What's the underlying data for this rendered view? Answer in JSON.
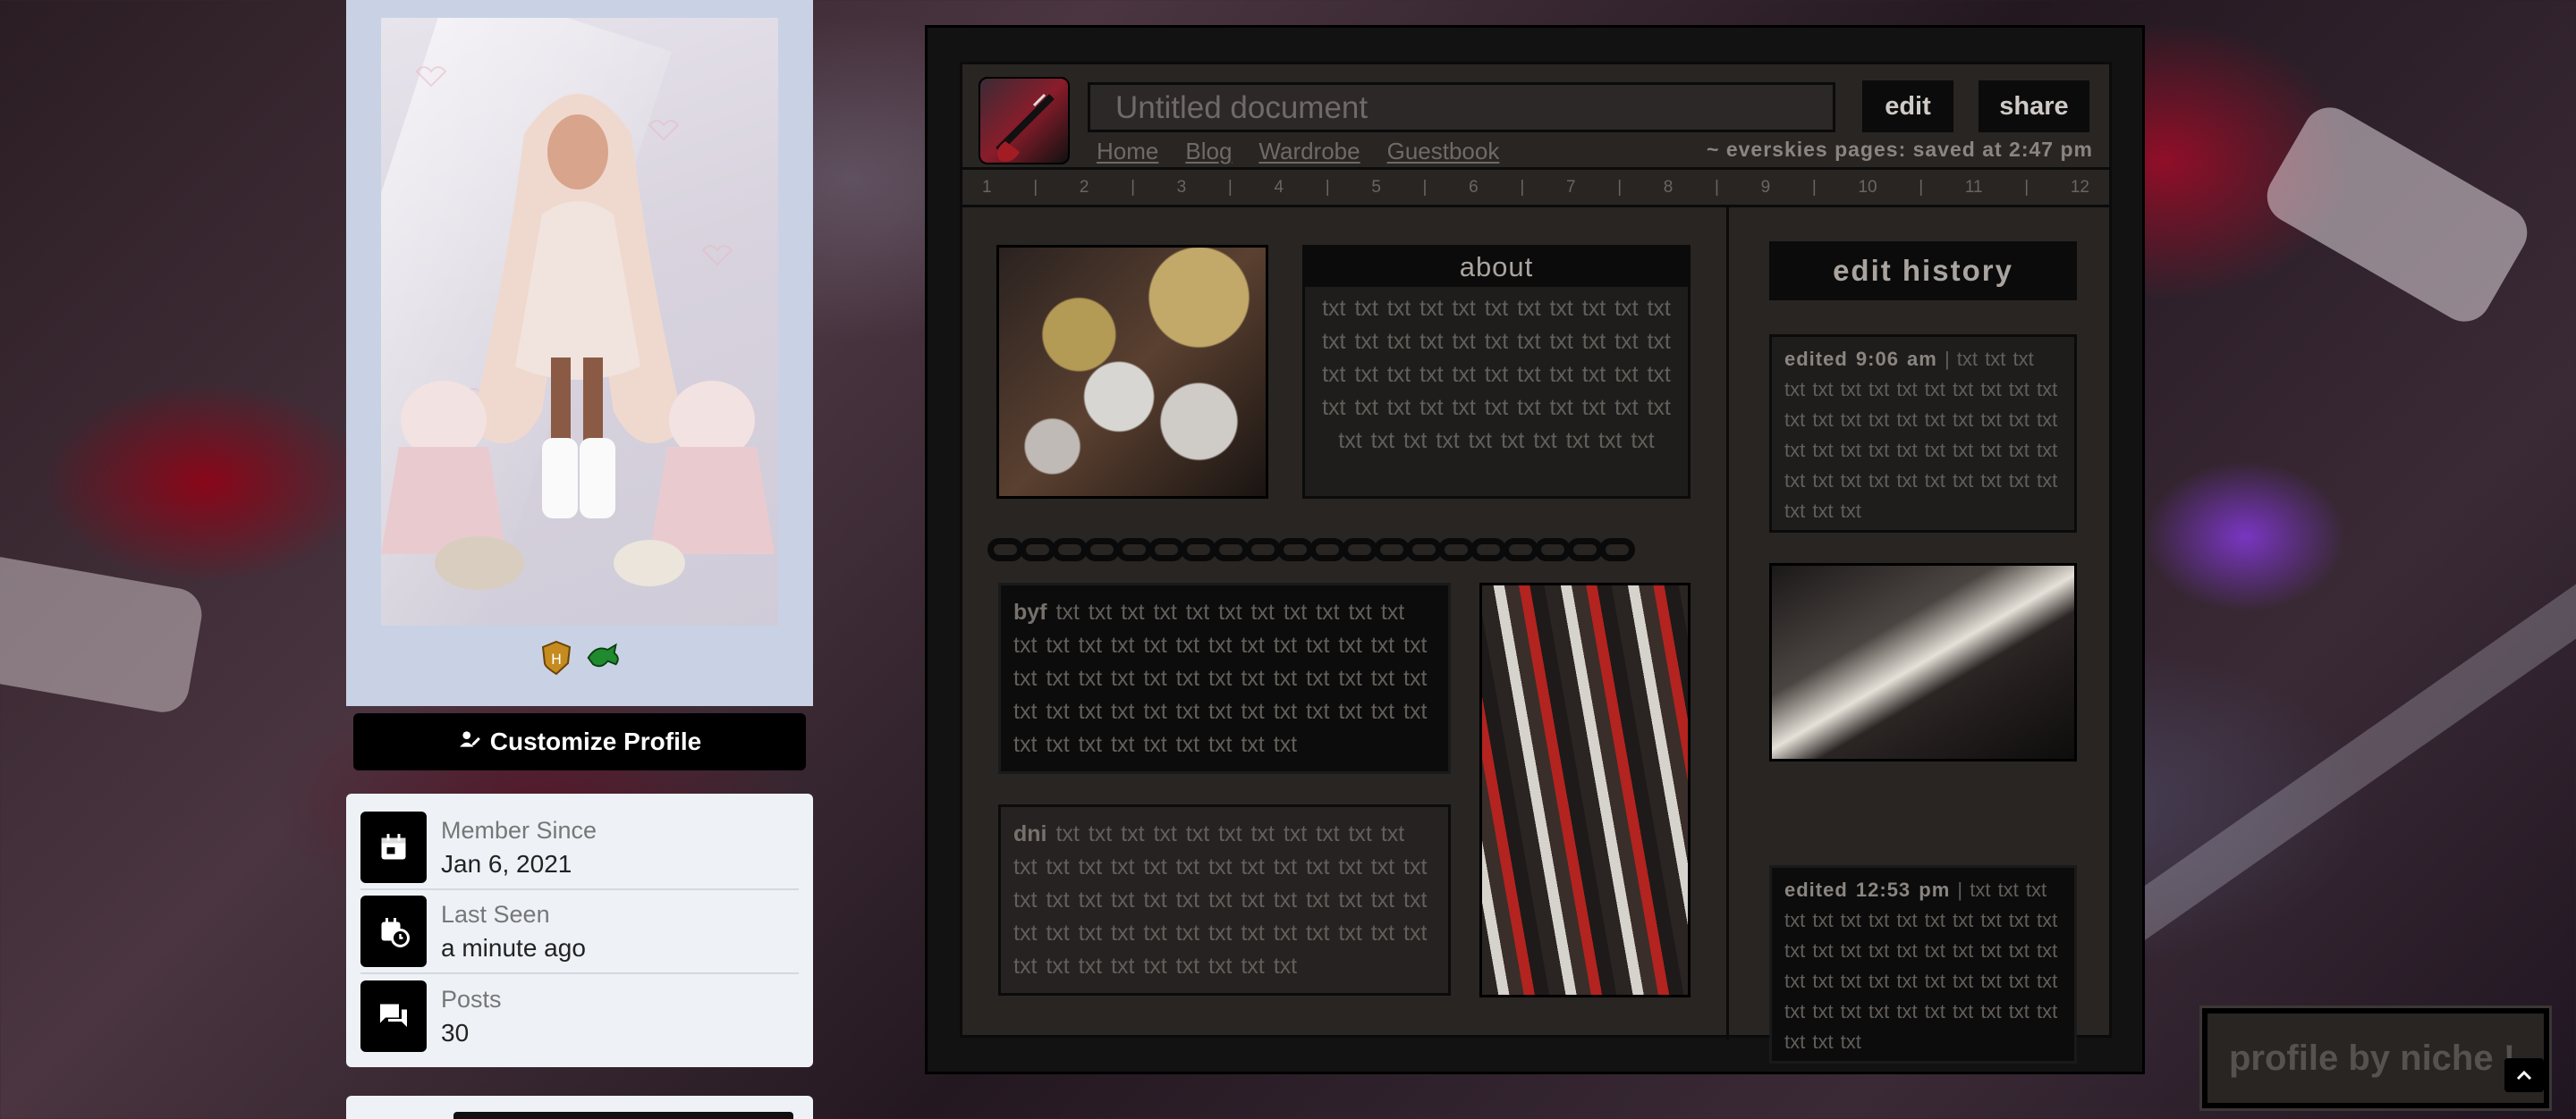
{
  "sidebar": {
    "customize_label": "Customize Profile",
    "stats": [
      {
        "label": "Member Since",
        "value": "Jan 6, 2021",
        "icon": "calendar-icon"
      },
      {
        "label": "Last Seen",
        "value": "a minute ago",
        "icon": "calendar-clock-icon"
      },
      {
        "label": "Posts",
        "value": "30",
        "icon": "chat-icon"
      }
    ]
  },
  "doc": {
    "title": "Untitled document",
    "edit_label": "edit",
    "share_label": "share",
    "nav": [
      "Home",
      "Blog",
      "Wardrobe",
      "Guestbook"
    ],
    "saved": "~ everskies pages: saved at 2:47 pm",
    "ruler": [
      "1",
      "|",
      "2",
      "|",
      "3",
      "|",
      "4",
      "|",
      "5",
      "|",
      "6",
      "|",
      "7",
      "|",
      "8",
      "|",
      "9",
      "|",
      "10",
      "|",
      "11",
      "|",
      "12"
    ],
    "about_title": "about",
    "about_text": "txt txt txt txt txt txt txt txt txt txt txt txt txt txt txt txt txt txt txt txt txt txt txt txt txt txt txt txt txt txt txt txt txt txt txt txt txt txt txt txt txt txt txt txt txt txt txt txt txt txt txt txt txt txt",
    "byf_lead": "byf",
    "byf_text": "txt txt txt txt txt txt txt txt txt txt txt txt txt txt txt txt txt txt txt txt txt txt txt txt txt txt txt txt txt txt txt txt txt txt txt txt txt txt txt txt txt txt txt txt txt txt txt txt txt txt txt txt txt txt txt txt txt txt txt",
    "dni_lead": "dni",
    "dni_text": "txt txt txt txt txt txt txt txt txt txt txt txt txt txt txt txt txt txt txt txt txt txt txt txt txt txt txt txt txt txt txt txt txt txt txt txt txt txt txt txt txt txt txt txt txt txt txt txt txt txt txt txt txt txt txt txt txt txt txt",
    "edit_history_title": "edit history",
    "history1_lead": "edited 9:06 am",
    "history1_text": "| txt txt txt txt txt txt txt txt txt txt txt txt txt txt txt txt txt txt txt txt txt txt txt txt txt txt txt txt txt txt txt txt txt txt txt txt txt txt txt txt txt txt txt txt txt txt",
    "history2_lead": "edited 12:53 pm",
    "history2_text": "| txt txt txt txt txt txt txt txt txt txt txt txt txt txt txt txt txt txt txt txt txt txt txt txt txt txt txt txt txt txt txt txt txt txt txt txt txt txt txt txt txt txt txt txt txt txt"
  },
  "credit": "profile by niche !",
  "to_top_icon": "chevron-up-icon"
}
